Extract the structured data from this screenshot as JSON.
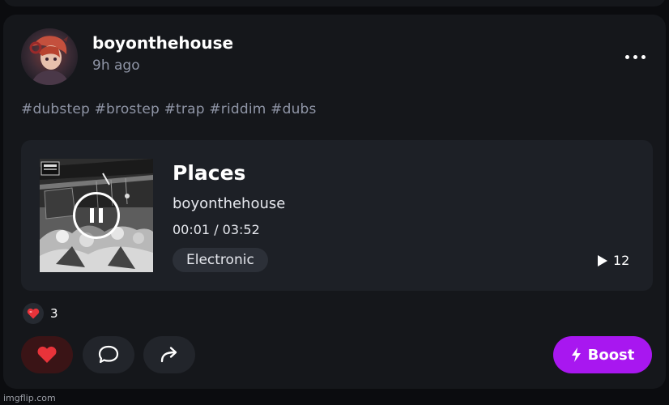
{
  "post": {
    "username": "boyonthehouse",
    "timestamp": "9h ago",
    "tags": "#dubstep #brostep #trap #riddim #dubs"
  },
  "track": {
    "title": "Places",
    "artist": "boyonthehouse",
    "time": "00:01 / 03:52",
    "genre": "Electronic",
    "play_count": "12",
    "progress_fraction": 0.0043
  },
  "reactions": {
    "emoji": "heart",
    "count": "3"
  },
  "actions": {
    "boost_label": "Boost",
    "boost_color": "#a817f0",
    "like_color": "#e8333a"
  },
  "watermark": "imgflip.com"
}
